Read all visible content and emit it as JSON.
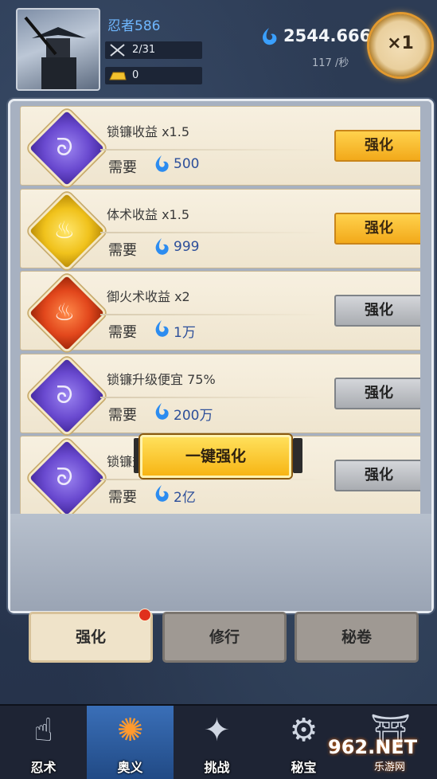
{
  "player": {
    "name": "忍者586",
    "kills": "2/31",
    "gold": "0"
  },
  "currency": {
    "amount": "2544.666",
    "rate": "117 /秒"
  },
  "multiplier": "×1",
  "cards": [
    {
      "title": "锁镰收益 x1.5",
      "need": "需要",
      "cost": "500",
      "button": "强化",
      "state": "active",
      "icon": "purple-sickle-icon"
    },
    {
      "title": "体术收益 x1.5",
      "need": "需要",
      "cost": "999",
      "button": "强化",
      "state": "active",
      "icon": "gold-flame-icon"
    },
    {
      "title": "御火术收益 x2",
      "need": "需要",
      "cost": "1万",
      "button": "强化",
      "state": "inactive",
      "icon": "red-fire-icon"
    },
    {
      "title": "锁镰升级便宜 75%",
      "need": "需要",
      "cost": "200万",
      "button": "强化",
      "state": "inactive",
      "icon": "purple-sickle-icon"
    },
    {
      "title": "锁镰升级便宜 75%",
      "need": "需要",
      "cost": "2亿",
      "button": "强化",
      "state": "inactive",
      "icon": "purple-sickle-icon"
    }
  ],
  "one_key": "一键强化",
  "tabs": [
    "强化",
    "修行",
    "秘卷"
  ],
  "nav": [
    {
      "label": "忍术",
      "icon": "finger-icon"
    },
    {
      "label": "奥义",
      "icon": "swirl-icon"
    },
    {
      "label": "挑战",
      "icon": "shuriken-icon"
    },
    {
      "label": "秘宝",
      "icon": "treasure-icon"
    },
    {
      "label": "",
      "icon": "temple-icon"
    }
  ],
  "watermark": {
    "brand": "962.NET",
    "sub": "乐游网"
  },
  "colors": {
    "accent": "#f2a91a",
    "currency": "#3aa0ff",
    "tab_dot": "#e0301c"
  }
}
